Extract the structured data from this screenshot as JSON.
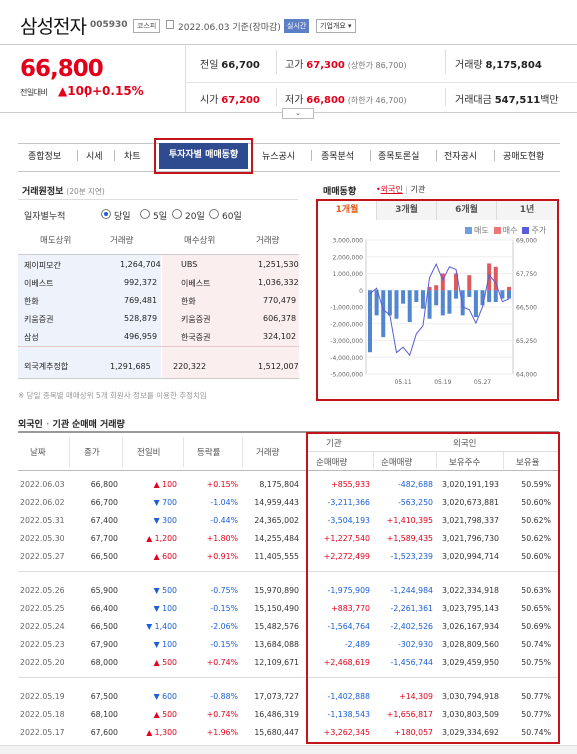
{
  "header": {
    "name": "삼성전자",
    "code": "005930",
    "market": "코스피",
    "date": "2022.06.03  기준(장마감)",
    "live_btn": "실시간",
    "overview_btn": "기업개요",
    "price": "66,800",
    "change_label": "전일대비",
    "change_value": "100",
    "change_pct": "+0.15%"
  },
  "summary": {
    "prev_close": {
      "label": "전일",
      "value": "66,700"
    },
    "high": {
      "label": "고가",
      "value": "67,300",
      "note": "(상한가 86,700)"
    },
    "volume": {
      "label": "거래량",
      "value": "8,175,804"
    },
    "open": {
      "label": "시가",
      "value": "67,200"
    },
    "low": {
      "label": "저가",
      "value": "66,800",
      "note": "(하한가 46,700)"
    },
    "amount": {
      "label": "거래대금",
      "value": "547,511",
      "unit": "백만"
    }
  },
  "tabs": [
    "종합정보",
    "시세",
    "차트",
    "투자자별 매매동향",
    "뉴스공시",
    "종목분석",
    "종목토론실",
    "전자공시",
    "공매도현황"
  ],
  "trader": {
    "title": "거래원정보",
    "subtitle": "(20분 지연)",
    "daily_label": "일자별누적",
    "options": [
      "당일",
      "5일",
      "20일",
      "60일"
    ],
    "selected": "당일",
    "headers": [
      "매도상위",
      "거래량",
      "매수상위",
      "거래량"
    ],
    "rows": [
      [
        "제이피모간",
        "1,264,704",
        "UBS",
        "1,251,530"
      ],
      [
        "이베스트",
        "992,372",
        "이베스트",
        "1,036,332"
      ],
      [
        "한화",
        "769,481",
        "한화",
        "770,479"
      ],
      [
        "키움증권",
        "528,879",
        "키움증권",
        "606,378"
      ],
      [
        "삼성",
        "496,959",
        "한국증권",
        "324,102"
      ]
    ],
    "foreign_label": "외국계추정합",
    "foreign_sell": "1,291,685",
    "foreign_diff": "220,322",
    "foreign_buy": "1,512,007",
    "note": "※ 당일 종목별 매매상위 5개 회원사 정보를 이용한 추정치임"
  },
  "trend": {
    "title": "매매동향",
    "opt_foreign": "외국인",
    "opt_inst": "기관",
    "periods": [
      "1개월",
      "3개월",
      "6개월",
      "1년"
    ],
    "active_period": "1개월",
    "legend": [
      "매도",
      "매수",
      "주가"
    ]
  },
  "chart_data": {
    "type": "bar",
    "x": [
      "05.04",
      "05.05",
      "05.06",
      "05.09",
      "05.10",
      "05.11",
      "05.12",
      "05.13",
      "05.16",
      "05.17",
      "05.18",
      "05.19",
      "05.20",
      "05.23",
      "05.24",
      "05.25",
      "05.26",
      "05.27",
      "05.30",
      "05.31",
      "06.02",
      "06.03"
    ],
    "x_ticks": [
      "05.11",
      "05.19",
      "05.27"
    ],
    "series": [
      {
        "name": "매도",
        "axis": "left",
        "values": [
          -3700000,
          -1500000,
          -2800000,
          -1500000,
          -1700000,
          -800000,
          -1900000,
          -700000,
          -1100000,
          -1700000,
          -900000,
          -1500000,
          -1400000,
          -500000,
          -1500000,
          -400000,
          -1600000,
          -900000,
          -700000,
          -700000,
          -500000,
          -500000
        ]
      },
      {
        "name": "매수",
        "axis": "left",
        "values": [
          0,
          0,
          0,
          0,
          0,
          0,
          0,
          0,
          0,
          200000,
          300000,
          1000000,
          0,
          1000000,
          0,
          900000,
          0,
          0,
          1600000,
          1400000,
          0,
          200000
        ]
      },
      {
        "name": "주가",
        "axis": "right",
        "values": [
          67000,
          67200,
          66400,
          66200,
          64800,
          65000,
          64700,
          65500,
          65800,
          67600,
          68100,
          67500,
          68000,
          67900,
          66500,
          66400,
          65900,
          66500,
          67700,
          67400,
          66700,
          66800
        ]
      }
    ],
    "ylim_left": [
      -5000000,
      3000000
    ],
    "ylim_right": [
      64000,
      69000
    ],
    "yticks_left": [
      "3,000,000",
      "2,000,000",
      "1,000,000",
      "0",
      "-1,000,000",
      "-2,000,000",
      "-3,000,000",
      "-4,000,000",
      "-5,000,000"
    ],
    "yticks_right": [
      "69,000",
      "67,750",
      "66,500",
      "65,250",
      "64,000"
    ],
    "colors": {
      "sell": "#3f79c9",
      "buy": "#d9474a",
      "price": "#5b5bd6"
    }
  },
  "net_trade": {
    "title_a": "외국인",
    "title_sep": "·",
    "title_b": "기관",
    "title_c": "순매매 거래량",
    "headers": {
      "date": "날짜",
      "close": "종가",
      "diff": "전일비",
      "rate": "등락률",
      "volume": "거래량",
      "inst": "기관",
      "foreign": "외국인",
      "inst_net": "순매매량",
      "for_net": "순매매량",
      "for_hold": "보유주수",
      "for_ratio": "보유율"
    },
    "groups": [
      [
        {
          "date": "2022.06.03",
          "close": "66,800",
          "dir": "up",
          "diff": "100",
          "rate": "+0.15%",
          "vol": "8,175,804",
          "inst": "+855,933",
          "for": "-482,688",
          "hold": "3,020,191,193",
          "ratio": "50.59%"
        },
        {
          "date": "2022.06.02",
          "close": "66,700",
          "dir": "down",
          "diff": "700",
          "rate": "-1.04%",
          "vol": "14,959,443",
          "inst": "-3,211,366",
          "for": "-563,250",
          "hold": "3,020,673,881",
          "ratio": "50.60%"
        },
        {
          "date": "2022.05.31",
          "close": "67,400",
          "dir": "down",
          "diff": "300",
          "rate": "-0.44%",
          "vol": "24,365,002",
          "inst": "-3,504,193",
          "for": "+1,410,395",
          "hold": "3,021,798,337",
          "ratio": "50.62%"
        },
        {
          "date": "2022.05.30",
          "close": "67,700",
          "dir": "up",
          "diff": "1,200",
          "rate": "+1.80%",
          "vol": "14,255,484",
          "inst": "+1,227,540",
          "for": "+1,589,435",
          "hold": "3,021,796,730",
          "ratio": "50.62%"
        },
        {
          "date": "2022.05.27",
          "close": "66,500",
          "dir": "up",
          "diff": "600",
          "rate": "+0.91%",
          "vol": "11,405,555",
          "inst": "+2,272,499",
          "for": "-1,523,239",
          "hold": "3,020,994,714",
          "ratio": "50.60%"
        }
      ],
      [
        {
          "date": "2022.05.26",
          "close": "65,900",
          "dir": "down",
          "diff": "500",
          "rate": "-0.75%",
          "vol": "15,970,890",
          "inst": "-1,975,909",
          "for": "-1,244,984",
          "hold": "3,022,334,918",
          "ratio": "50.63%"
        },
        {
          "date": "2022.05.25",
          "close": "66,400",
          "dir": "down",
          "diff": "100",
          "rate": "-0.15%",
          "vol": "15,150,490",
          "inst": "+883,770",
          "for": "-2,261,361",
          "hold": "3,023,795,143",
          "ratio": "50.65%"
        },
        {
          "date": "2022.05.24",
          "close": "66,500",
          "dir": "down",
          "diff": "1,400",
          "rate": "-2.06%",
          "vol": "15,482,576",
          "inst": "-1,564,764",
          "for": "-2,402,526",
          "hold": "3,026,167,934",
          "ratio": "50.69%"
        },
        {
          "date": "2022.05.23",
          "close": "67,900",
          "dir": "down",
          "diff": "100",
          "rate": "-0.15%",
          "vol": "13,684,088",
          "inst": "-2,489",
          "for": "-302,930",
          "hold": "3,028,809,560",
          "ratio": "50.74%"
        },
        {
          "date": "2022.05.20",
          "close": "68,000",
          "dir": "up",
          "diff": "500",
          "rate": "+0.74%",
          "vol": "12,109,671",
          "inst": "+2,468,619",
          "for": "-1,456,744",
          "hold": "3,029,459,950",
          "ratio": "50.75%"
        }
      ],
      [
        {
          "date": "2022.05.19",
          "close": "67,500",
          "dir": "down",
          "diff": "600",
          "rate": "-0.88%",
          "vol": "17,073,727",
          "inst": "-1,402,888",
          "for": "+14,309",
          "hold": "3,030,794,918",
          "ratio": "50.77%"
        },
        {
          "date": "2022.05.18",
          "close": "68,100",
          "dir": "up",
          "diff": "500",
          "rate": "+0.74%",
          "vol": "16,486,319",
          "inst": "-1,138,543",
          "for": "+1,656,817",
          "hold": "3,030,803,509",
          "ratio": "50.77%"
        },
        {
          "date": "2022.05.17",
          "close": "67,600",
          "dir": "up",
          "diff": "1,300",
          "rate": "+1.96%",
          "vol": "15,680,447",
          "inst": "+3,262,345",
          "for": "+180,057",
          "hold": "3,029,334,692",
          "ratio": "50.74%"
        }
      ]
    ]
  }
}
